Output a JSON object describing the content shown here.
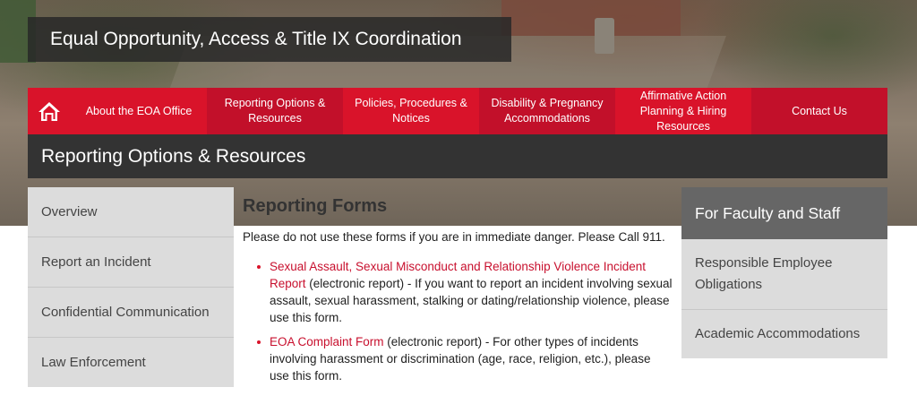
{
  "site": {
    "title": "Equal Opportunity, Access & Title IX Coordination"
  },
  "nav": {
    "items": [
      {
        "label": "About the EOA Office"
      },
      {
        "label": "Reporting Options & Resources"
      },
      {
        "label": "Policies, Procedures & Notices"
      },
      {
        "label": "Disability & Pregnancy Accommodations"
      },
      {
        "label": "Affirmative Action Planning & Hiring Resources"
      },
      {
        "label": "Contact Us"
      }
    ]
  },
  "page": {
    "title": "Reporting Options & Resources"
  },
  "sidebar": {
    "items": [
      {
        "label": "Overview"
      },
      {
        "label": "Report an Incident"
      },
      {
        "label": "Confidential Communication"
      },
      {
        "label": "Law Enforcement"
      }
    ]
  },
  "main": {
    "heading": "Reporting Forms",
    "intro": "Please do not use these forms if you are in immediate danger. Please Call 911.",
    "forms": [
      {
        "link": "Sexual Assault, Sexual Misconduct and Relationship Violence Incident Report",
        "desc": " (electronic report) - If you want to report an incident involving sexual assault, sexual harassment, stalking or dating/relationship violence, please use this form."
      },
      {
        "link": "EOA Complaint Form",
        "desc": " (electronic report) - For other types of incidents involving harassment or discrimination (age, race, religion, etc.), please use this form."
      }
    ]
  },
  "rightbox": {
    "heading": "For Faculty and Staff",
    "items": [
      {
        "label": "Responsible Employee Obligations"
      },
      {
        "label": "Academic Accommodations"
      }
    ]
  },
  "colors": {
    "brand_red": "#d9132a",
    "dark_bar": "#333333",
    "link_red": "#c8102e"
  }
}
